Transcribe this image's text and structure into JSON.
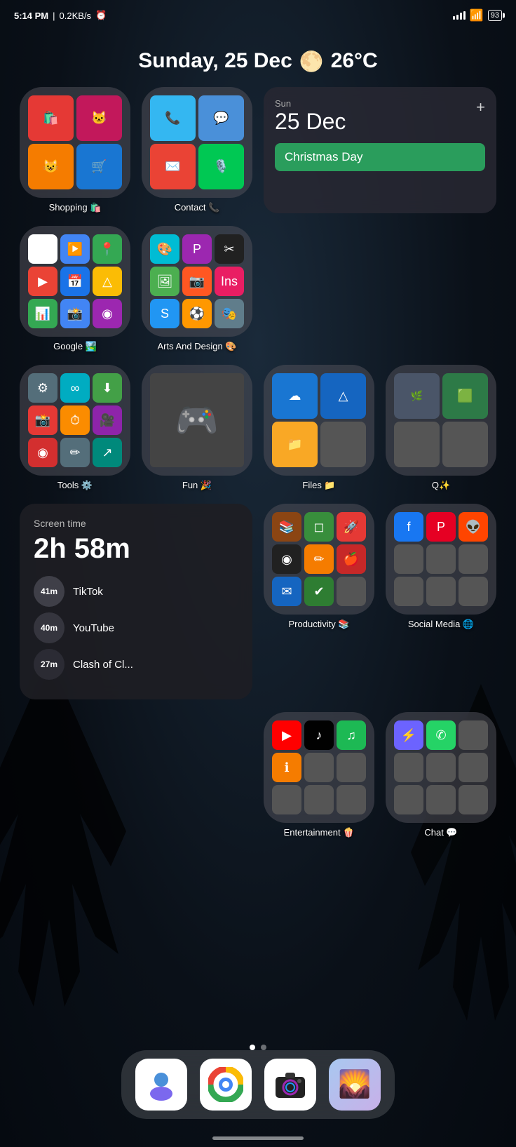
{
  "statusBar": {
    "time": "5:14 PM",
    "network": "0.2KB/s",
    "battery": "93"
  },
  "dateWeather": {
    "text": "Sunday, 25 Dec",
    "temp": "26°C"
  },
  "calendar": {
    "dayName": "Sun",
    "date": "25 Dec",
    "event": "Christmas Day",
    "addButton": "+"
  },
  "row1": {
    "shopping": {
      "label": "Shopping 🛍️"
    },
    "contact": {
      "label": "Contact 📞"
    }
  },
  "row2": {
    "google": {
      "label": "Google 🏞️"
    },
    "artsDesign": {
      "label": "Arts And Design 🎨"
    }
  },
  "row3": {
    "tools": {
      "label": "Tools ⚙️"
    },
    "fun": {
      "label": "Fun 🎉"
    },
    "files": {
      "label": "Files 📁"
    },
    "aiChat": {
      "label": "Q✨"
    }
  },
  "screenTime": {
    "label": "Screen time",
    "total": "2h 58m",
    "apps": [
      {
        "time": "41m",
        "name": "TikTok"
      },
      {
        "time": "40m",
        "name": "YouTube"
      },
      {
        "time": "27m",
        "name": "Clash of Cl..."
      }
    ]
  },
  "row4Apps": {
    "productivity": {
      "label": "Productivity 📚"
    },
    "socialMedia": {
      "label": "Social Media 🌐"
    }
  },
  "row5Apps": {
    "entertainment": {
      "label": "Entertainment 🍿"
    },
    "chat": {
      "label": "Chat 💬"
    }
  },
  "dock": {
    "contacts": "👤",
    "chrome": "🌐",
    "camera": "📷",
    "photos": "🖼️"
  },
  "pageDots": [
    true,
    false
  ]
}
